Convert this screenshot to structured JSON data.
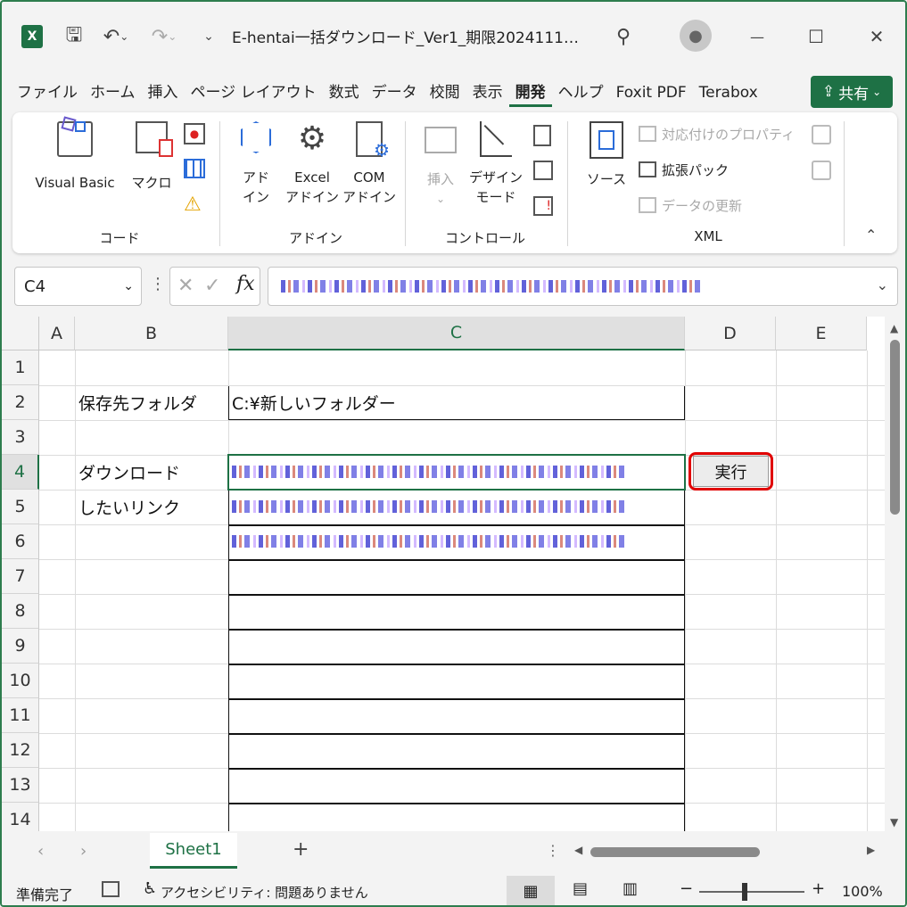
{
  "window": {
    "title": "E-hentai一括ダウンロード_Ver1_期限2024111…",
    "minimize": "—",
    "maximize": "☐",
    "close": "✕"
  },
  "tabs": [
    "ファイル",
    "ホーム",
    "挿入",
    "ページ レイアウト",
    "数式",
    "データ",
    "校閲",
    "表示",
    "開発",
    "ヘルプ",
    "Foxit PDF",
    "Terabox"
  ],
  "active_tab": "開発",
  "share_label": "共有",
  "ribbon": {
    "code": {
      "visual_basic": "Visual Basic",
      "macro": "マクロ",
      "group": "コード"
    },
    "addin": {
      "addin": "アド\nイン",
      "excel_addin": "Excel\nアドイン",
      "com_addin": "COM\nアドイン",
      "group": "アドイン"
    },
    "controls": {
      "insert": "挿入",
      "design_mode": "デザイン\nモード",
      "group": "コントロール"
    },
    "xml": {
      "source": "ソース",
      "map_props": "対応付けのプロパティ",
      "expansion": "拡張パック",
      "refresh": "データの更新",
      "group": "XML"
    }
  },
  "namebox": "C4",
  "columns": [
    "A",
    "B",
    "C",
    "D",
    "E"
  ],
  "rows": [
    "1",
    "2",
    "3",
    "4",
    "5",
    "6",
    "7",
    "8",
    "9",
    "10",
    "11",
    "12",
    "13",
    "14"
  ],
  "cells": {
    "B2": "保存先フォルダ",
    "C2": "C:¥新しいフォルダー",
    "B4": "ダウンロード",
    "B5": "したいリンク"
  },
  "button_exec": "実行",
  "sheet_tab": "Sheet1",
  "status": {
    "ready": "準備完了",
    "accessibility": "アクセシビリティ: 問題ありません",
    "zoom": "100%"
  }
}
